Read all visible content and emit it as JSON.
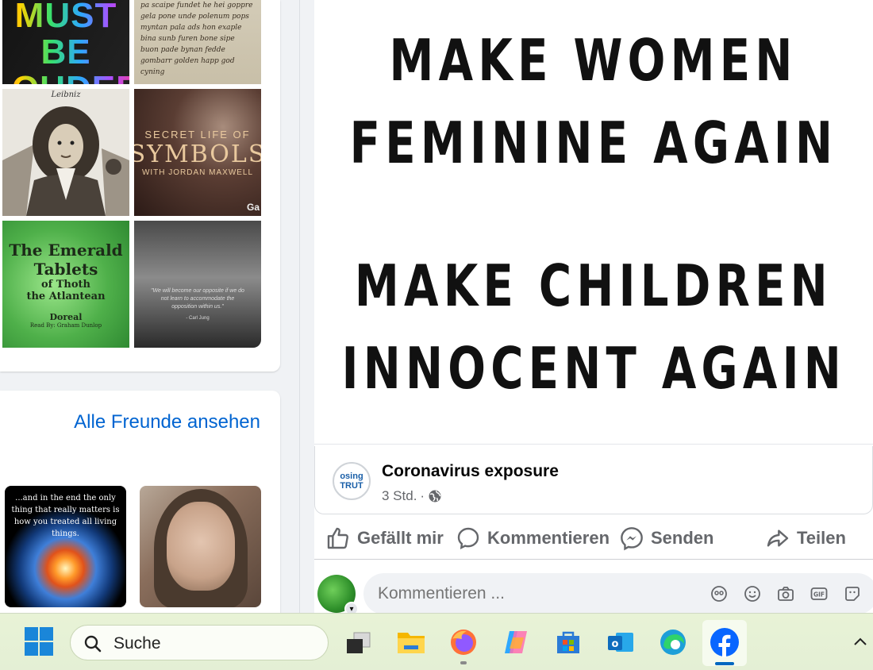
{
  "photos": {
    "p1_text": "LOVE MUST BE LOUDER",
    "p2_text": "pa scaipe fundet he hei goppre gela pone unde polenum pops myntan pala ads hon exaple bina sunb furen bone sipe buon pade bynan fedde gombarr golden happ god cyning",
    "p3_text": "Leibniz",
    "p4_line1": "SECRET LIFE OF",
    "p4_line2": "SYMBOLS",
    "p4_line3": "WITH JORDAN MAXWELL",
    "p4_corner": "Ga",
    "p5_line1": "The Emerald",
    "p5_line2": "Tablets",
    "p5_line3": "of Thoth",
    "p5_line4": "the Atlantean",
    "p5_line5": "Doreal",
    "p5_line6": "Read By: Graham Dunlop",
    "p6_quote": "\"We will become our opposite if we do not learn to accommodate the opposition within us.\"",
    "p6_author": "- Carl Jung"
  },
  "friends": {
    "see_all": "Alle Freunde ansehen",
    "f1_quote": "...and in the end the only thing that really matters is how you treated all living things."
  },
  "post": {
    "meme_lines": [
      "MAKE WOMEN",
      "FEMININE AGAIN",
      "MAKE CHILDREN",
      "INNOCENT AGAIN"
    ],
    "share_avatar_text": "osing TRUT",
    "share_title": "Coronavirus exposure",
    "share_time": "3 Std.",
    "share_sep": "·",
    "actions": {
      "like": "Gefällt mir",
      "comment": "Kommentieren",
      "send": "Senden",
      "share": "Teilen"
    },
    "comment_placeholder": "Kommentieren ..."
  },
  "taskbar": {
    "search_label": "Suche",
    "apps": [
      "task-view",
      "file-explorer",
      "firefox",
      "copilot",
      "microsoft-store",
      "outlook",
      "edge",
      "facebook"
    ]
  },
  "colors": {
    "link": "#0064d1",
    "facebook": "#0866ff",
    "taskbar": "#e6f1d6"
  }
}
